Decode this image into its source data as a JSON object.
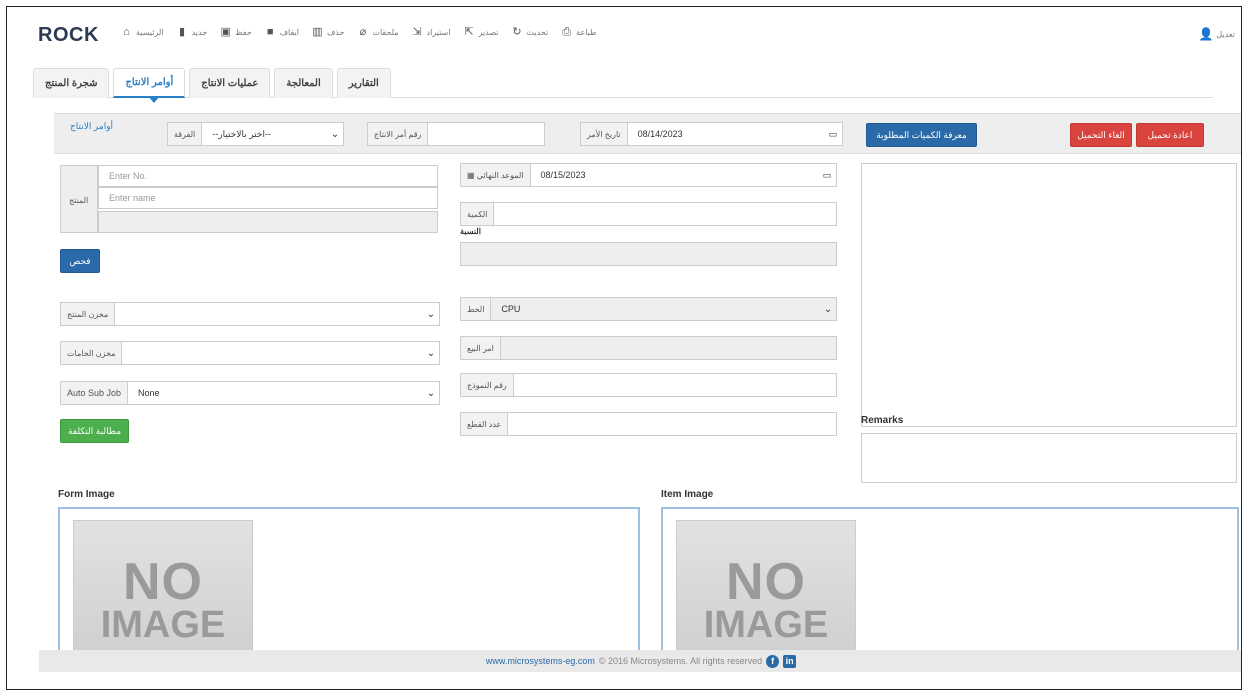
{
  "app": {
    "brand": "ROCK"
  },
  "nav": {
    "items": [
      {
        "label": "الرئيسية",
        "icon": "home-icon",
        "glyph": "⌂"
      },
      {
        "label": "جديد",
        "icon": "new-file-icon",
        "glyph": "▮"
      },
      {
        "label": "حفظ",
        "icon": "save-icon",
        "glyph": "▣"
      },
      {
        "label": "ايقاف",
        "icon": "stop-icon",
        "glyph": "■"
      },
      {
        "label": "حذف",
        "icon": "trash-icon",
        "glyph": "▥"
      },
      {
        "label": "ملحقات",
        "icon": "paperclip-icon",
        "glyph": "⌀"
      },
      {
        "label": "استيراد",
        "icon": "import-icon",
        "glyph": "⇲"
      },
      {
        "label": "تصدير",
        "icon": "export-icon",
        "glyph": "⇱"
      },
      {
        "label": "تحديث",
        "icon": "refresh-icon",
        "glyph": "↻"
      },
      {
        "label": "طباعة",
        "icon": "print-icon",
        "glyph": "⎙"
      }
    ],
    "user": "تعديل"
  },
  "tabs": [
    {
      "label": "شجرة المنتج",
      "active": false
    },
    {
      "label": "أوامر الانتاج",
      "active": true
    },
    {
      "label": "عمليات الانتاج",
      "active": false
    },
    {
      "label": "المعالجة",
      "active": false
    },
    {
      "label": "التقارير",
      "active": false
    }
  ],
  "header": {
    "title": "أوامر الانتاج",
    "branch_label": "الفرقة",
    "branch_value": "--اختر بالاختيار--",
    "order_no_label": "رقم أمر الانتاج",
    "order_date_label": "تاريخ الأمر",
    "order_date_value": "08/14/2023",
    "btn_required_qty": "معرفة الكميات المطلوبة",
    "btn_cancel": "الغاء التحميل",
    "btn_reload": "اعادة تحميل"
  },
  "form": {
    "product_label": "المنتج",
    "product_no_placeholder": "Enter No.",
    "product_name_placeholder": "Enter name",
    "check_button": "فحص",
    "product_store_label": "مخزن المنتج",
    "materials_store_label": "مخزن الخامات",
    "auto_sub_job_label": "Auto Sub Job",
    "auto_sub_job_value": "None",
    "cost_button": "مطالبة التكلفة",
    "due_date_label": "الموعد النهائي",
    "due_date_value": "08/15/2023",
    "qty_label": "الكمية",
    "percent_label": "النسبة",
    "line_label": "الخط",
    "line_value": "CPU",
    "sales_order_label": "امر البيع",
    "model_no_label": "رقم النموذج",
    "pieces_label": "عدد القطع",
    "remarks_label": "Remarks"
  },
  "images": {
    "form_image_label": "Form Image",
    "item_image_label": "Item Image",
    "placeholder_line1": "NO",
    "placeholder_line2": "IMAGE"
  },
  "footer": {
    "link": "www.microsystems-eg.com",
    "copyright": "© 2016 Microsystems. All rights reserved"
  },
  "colors": {
    "primary": "#2a6aa8",
    "danger": "#d9443f",
    "success": "#4cae4c",
    "accent": "#2a7fc9"
  }
}
